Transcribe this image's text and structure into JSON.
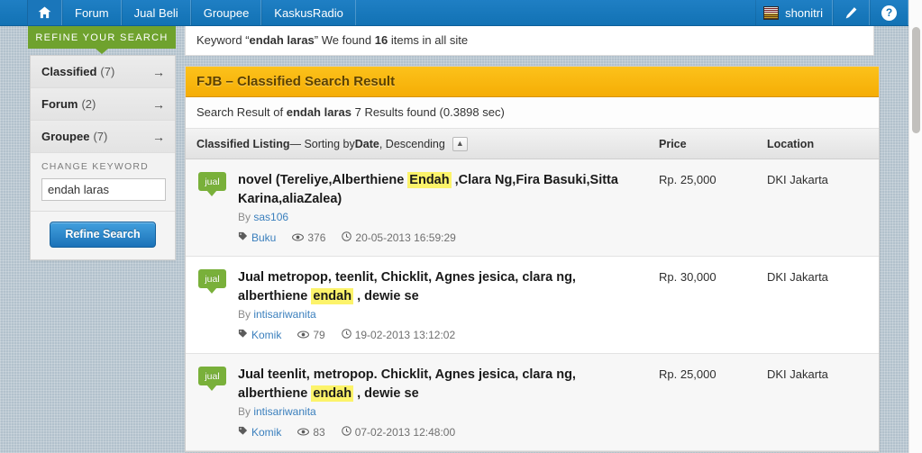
{
  "navbar": {
    "home_icon": "home-icon",
    "items": [
      {
        "label": "Forum"
      },
      {
        "label": "Jual Beli"
      },
      {
        "label": "Groupee"
      },
      {
        "label": "KaskusRadio"
      }
    ],
    "username": "shonitri",
    "avatar_icon": "avatar-image",
    "edit_icon": "pencil-icon",
    "help_icon": "question-mark-icon"
  },
  "sidebar": {
    "header": "REFINE YOUR SEARCH",
    "items": [
      {
        "label": "Classified",
        "count": "(7)",
        "arrow": "→"
      },
      {
        "label": "Forum",
        "count": "(2)",
        "arrow": "→"
      },
      {
        "label": "Groupee",
        "count": "(7)",
        "arrow": "→"
      }
    ],
    "keyword_label": "CHANGE KEYWORD",
    "keyword_value": "endah laras",
    "keyword_placeholder": "endah laras",
    "refine_button": "Refine Search"
  },
  "keyword_bar": {
    "prefix": "Keyword “",
    "keyword": "endah laras",
    "suffix_before_count": "” We found ",
    "count": "16",
    "suffix": " items in all site"
  },
  "panel": {
    "title": "FJB – Classified Search Result",
    "summary_prefix": "Search Result of ",
    "summary_keyword": "endah laras",
    "summary_suffix": " 7 Results found (0.3898 sec)",
    "listing_label": "Classified Listing",
    "listing_dash": " — Sorting by ",
    "sort_field": "Date",
    "sort_dir": ", Descending",
    "sort_toggle_icon": "chevron-up-icon",
    "col_price": "Price",
    "col_location": "Location"
  },
  "listings": [
    {
      "badge": "jual",
      "title_part1": "novel (Tereliye,Alberthiene ",
      "title_highlight": "Endah",
      "title_part2": " ,Clara Ng,Fira Basuki,Sitta Karina,aliaZalea)",
      "by_label": "By ",
      "author": "sas106",
      "tag": "Buku",
      "views": "376",
      "date": "20-05-2013 16:59:29",
      "price": "Rp. 25,000",
      "location": "DKI Jakarta"
    },
    {
      "badge": "jual",
      "title_part1": "Jual metropop, teenlit, Chicklit, Agnes jesica, clara ng, alberthiene ",
      "title_highlight": "endah",
      "title_part2": " , dewie se",
      "by_label": "By ",
      "author": "intisariwanita",
      "tag": "Komik",
      "views": "79",
      "date": "19-02-2013 13:12:02",
      "price": "Rp. 30,000",
      "location": "DKI Jakarta"
    },
    {
      "badge": "jual",
      "title_part1": "Jual teenlit, metropop. Chicklit, Agnes jesica, clara ng, alberthiene ",
      "title_highlight": "endah",
      "title_part2": " , dewie se",
      "by_label": "By ",
      "author": "intisariwanita",
      "tag": "Komik",
      "views": "83",
      "date": "07-02-2013 12:48:00",
      "price": "Rp. 25,000",
      "location": "DKI Jakarta"
    }
  ],
  "colors": {
    "navbar_blue": "#1272b4",
    "refine_green": "#6fa22e",
    "panel_orange": "#f5ad05",
    "badge_green": "#79b03a",
    "highlight_yellow": "#fcf36a",
    "link_blue": "#3a7fbd",
    "page_bg": "#b2c1cc"
  }
}
